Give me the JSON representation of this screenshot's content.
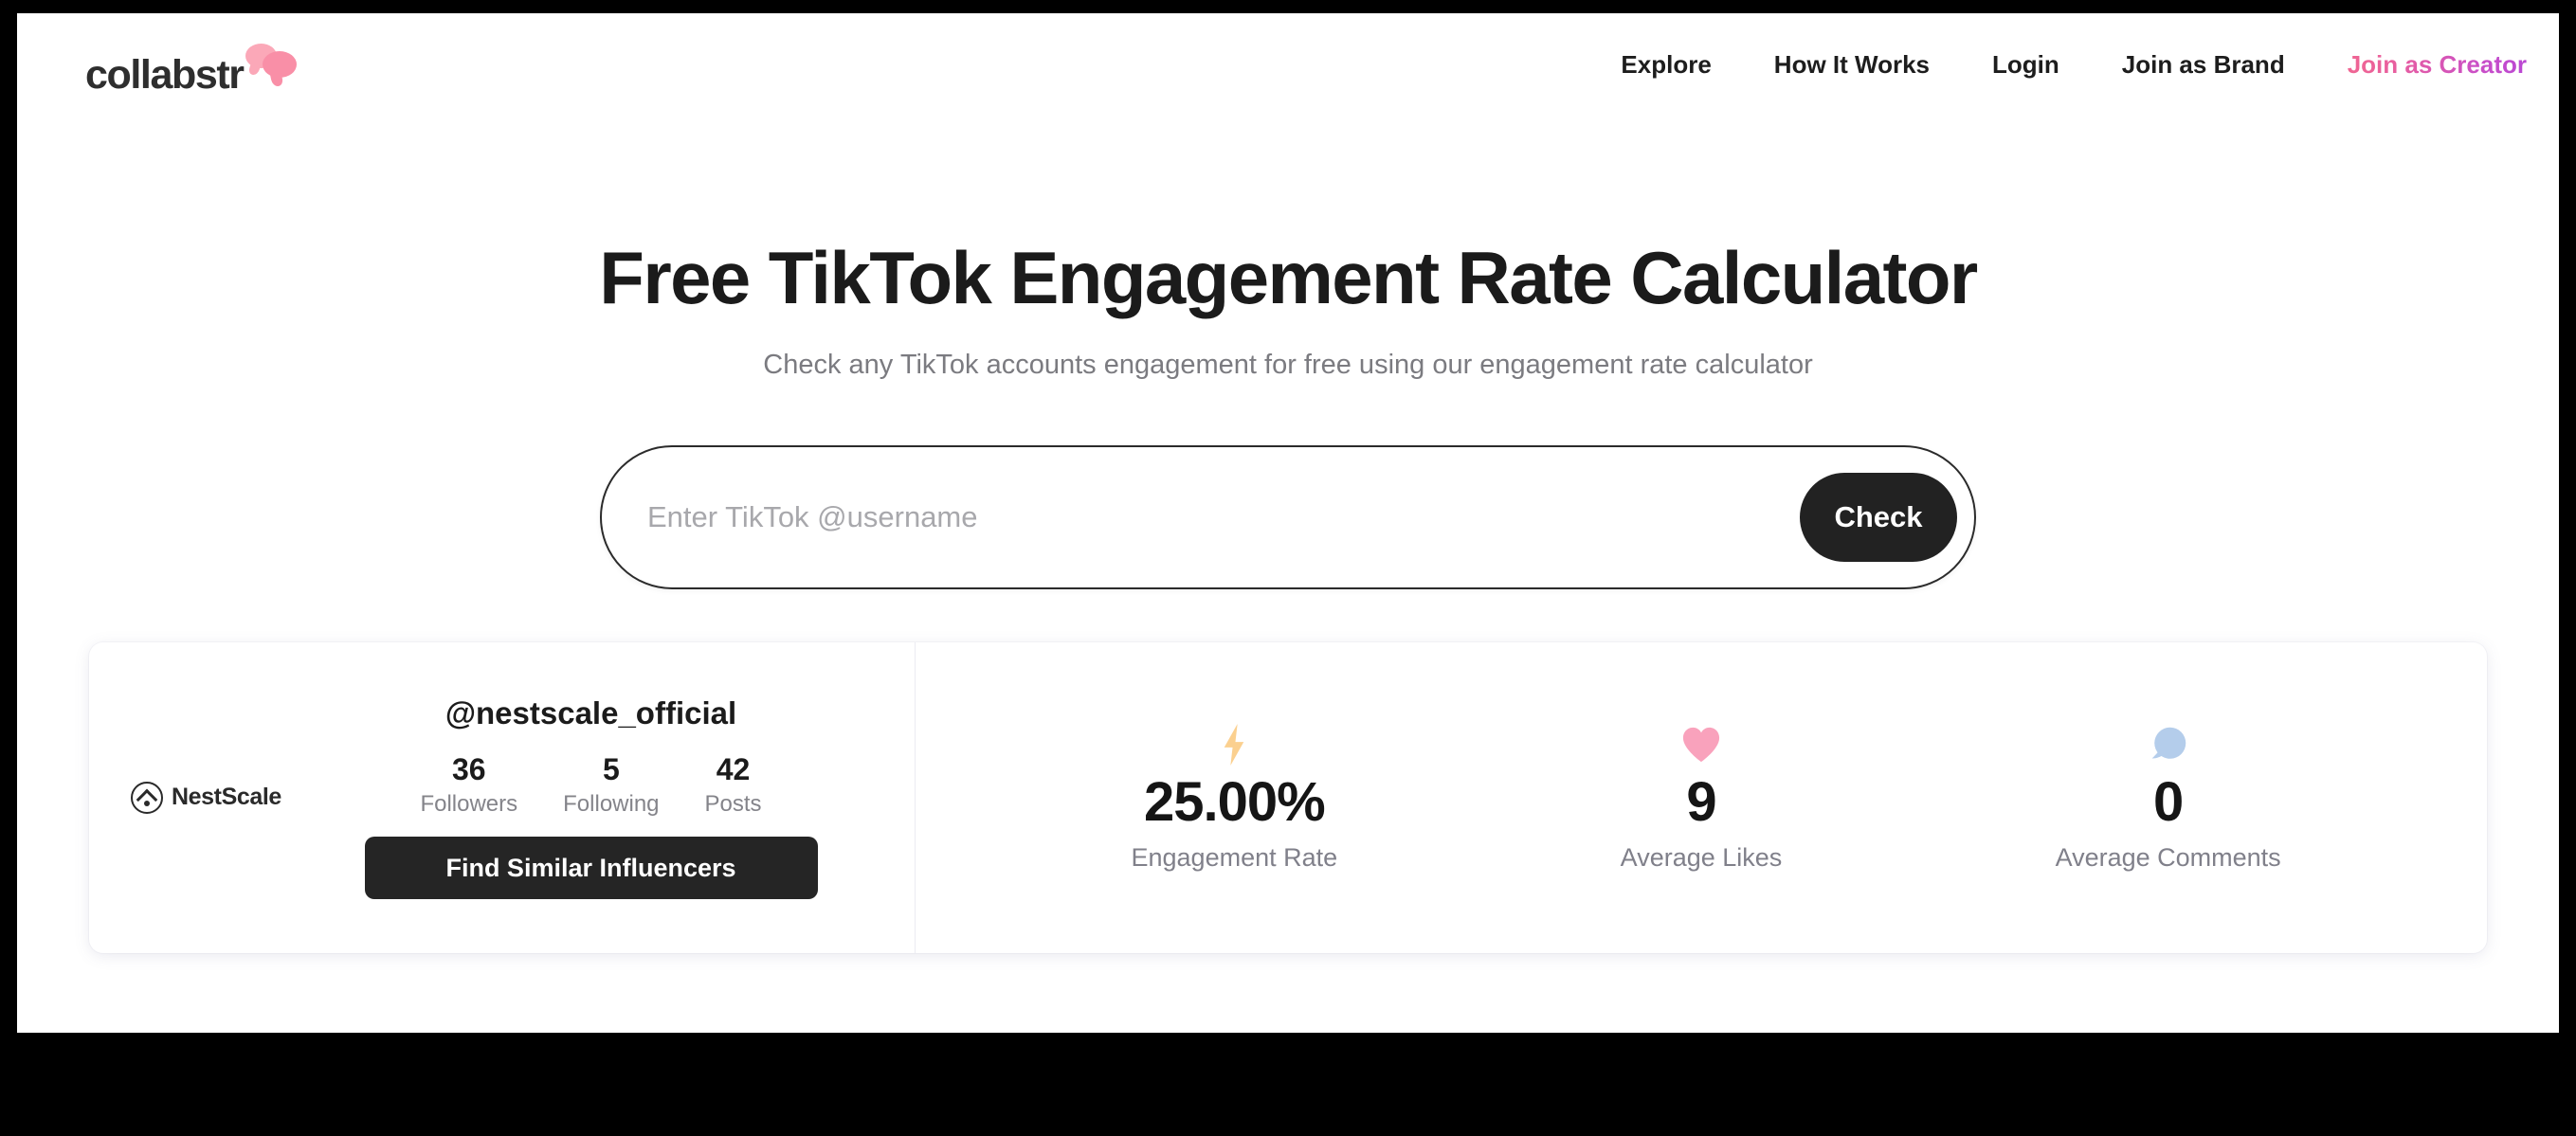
{
  "brand": {
    "name": "collabstr",
    "logo_icon": "speech-bubbles-icon"
  },
  "nav": {
    "items": [
      {
        "label": "Explore",
        "accent": false
      },
      {
        "label": "How It Works",
        "accent": false
      },
      {
        "label": "Login",
        "accent": false
      },
      {
        "label": "Join as Brand",
        "accent": false
      },
      {
        "label": "Join as Creator",
        "accent": true
      }
    ]
  },
  "hero": {
    "title": "Free TikTok Engagement Rate Calculator",
    "subtitle": "Check any TikTok accounts engagement for free using our engagement rate calculator"
  },
  "search": {
    "placeholder": "Enter TikTok @username",
    "value": "",
    "button_label": "Check"
  },
  "result": {
    "profile": {
      "avatar_name": "NestScale",
      "avatar_icon": "nestscale-logo-icon",
      "handle": "@nestscale_official",
      "stats": [
        {
          "value": "36",
          "label": "Followers"
        },
        {
          "value": "5",
          "label": "Following"
        },
        {
          "value": "42",
          "label": "Posts"
        }
      ],
      "cta_label": "Find Similar Influencers"
    },
    "metrics": [
      {
        "icon": "lightning-bolt-icon",
        "value": "25.00%",
        "label": "Engagement Rate",
        "color": "#fbd08f"
      },
      {
        "icon": "heart-icon",
        "value": "9",
        "label": "Average Likes",
        "color": "#f9a2bc"
      },
      {
        "icon": "speech-bubble-icon",
        "value": "0",
        "label": "Average Comments",
        "color": "#b4cdeb"
      }
    ]
  },
  "colors": {
    "accent_pink": "#f56a8a",
    "accent_purple": "#b444d8",
    "dark": "#222222",
    "muted_text": "#80808a",
    "page_frame": "#000000"
  }
}
